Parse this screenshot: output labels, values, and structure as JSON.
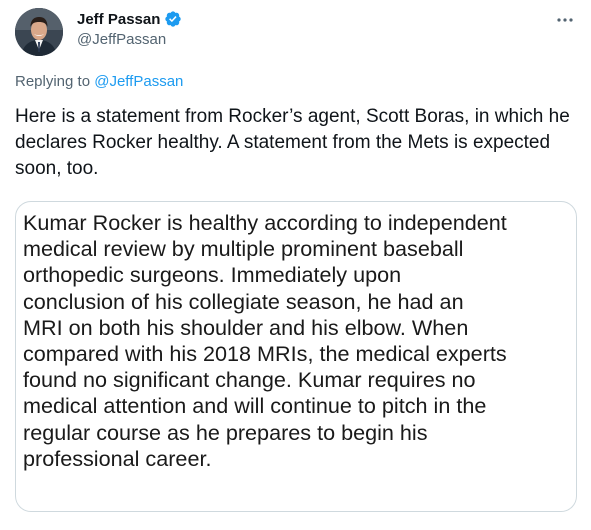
{
  "author": {
    "display_name": "Jeff Passan",
    "handle": "@JeffPassan",
    "verified": true
  },
  "reply_context": {
    "prefix": "Replying to",
    "target": "@JeffPassan"
  },
  "tweet": {
    "text": "Here is a statement from Rocker’s agent, Scott Boras, in which he declares Rocker healthy. A statement from the Mets is expected soon, too."
  },
  "media": {
    "statement_text": "Kumar Rocker is healthy according to independent\nmedical review by multiple prominent baseball\northopedic surgeons. Immediately upon\nconclusion of his collegiate season, he had an\nMRI on both his shoulder and his elbow. When\ncompared with his 2018 MRIs, the medical experts\nfound no significant change. Kumar requires no\nmedical attention and will continue to pitch in the\nregular course as he prepares to begin his\nprofessional career."
  },
  "colors": {
    "accent": "#1d9bf0",
    "secondary_text": "#536471",
    "primary_text": "#0f1419",
    "border": "#cfd9de"
  },
  "icons": {
    "verified": "verified-badge-icon",
    "more": "more-options-icon"
  }
}
